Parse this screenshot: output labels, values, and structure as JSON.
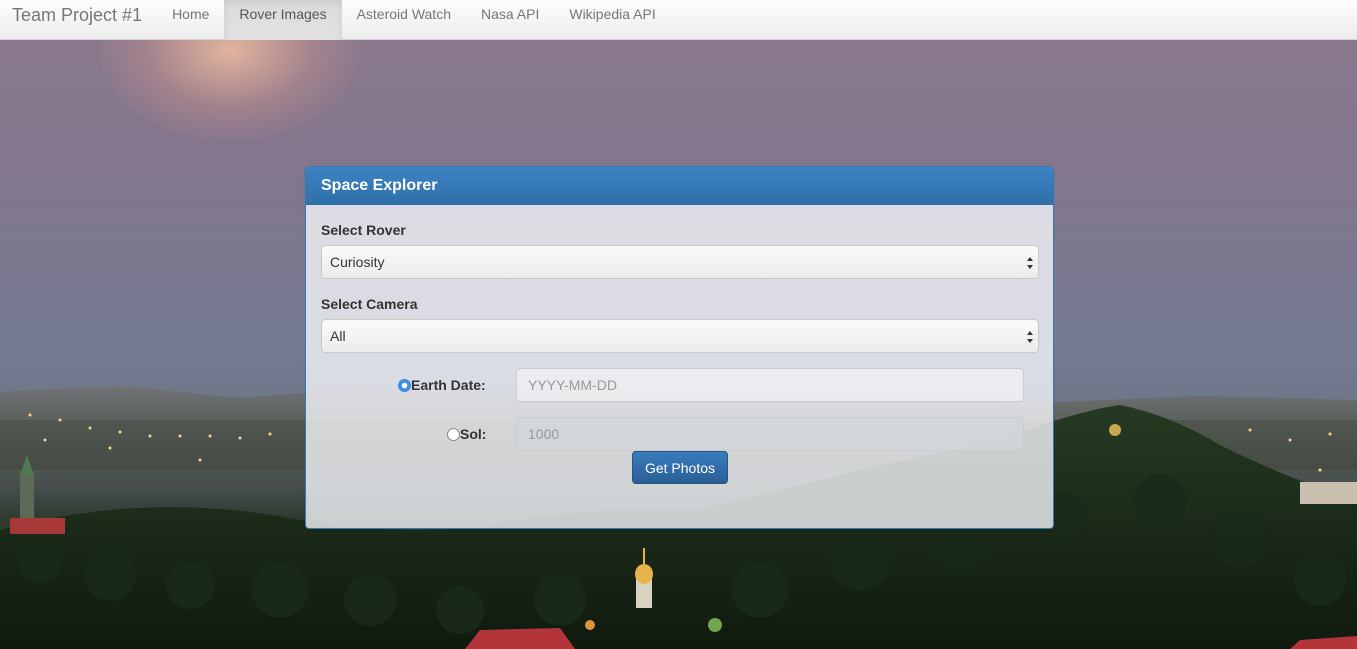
{
  "navbar": {
    "brand": "Team Project #1",
    "items": [
      {
        "label": "Home",
        "active": false
      },
      {
        "label": "Rover Images",
        "active": true
      },
      {
        "label": "Asteroid Watch",
        "active": false
      },
      {
        "label": "Nasa API",
        "active": false
      },
      {
        "label": "Wikipedia API",
        "active": false
      }
    ]
  },
  "panel": {
    "title": "Space Explorer",
    "rover": {
      "label": "Select Rover",
      "selected": "Curiosity"
    },
    "camera": {
      "label": "Select Camera",
      "selected": "All"
    },
    "earth_date": {
      "label": "Earth Date:",
      "placeholder": "YYYY-MM-DD",
      "checked": true
    },
    "sol": {
      "label": "Sol:",
      "placeholder": "1000",
      "checked": false
    },
    "submit_label": "Get Photos"
  },
  "colors": {
    "panel_header": "#337ab7",
    "button": "#2e6da4",
    "radio_checked": "#3b8fe6"
  }
}
